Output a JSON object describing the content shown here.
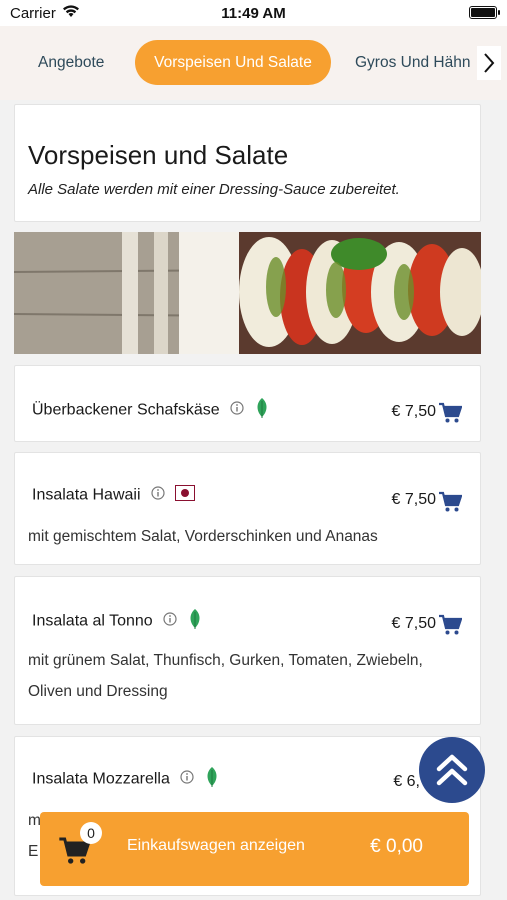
{
  "status_bar": {
    "carrier": "Carrier",
    "time": "11:49 AM"
  },
  "tabs": [
    {
      "label": "Angebote",
      "active": false
    },
    {
      "label": "Vorspeisen Und Salate",
      "active": true
    },
    {
      "label": "Gyros Und Hähn",
      "active": false
    }
  ],
  "section": {
    "title": "Vorspeisen und Salate",
    "subtitle": "Alle Salate werden mit einer Dressing-Sauce zubereitet."
  },
  "items": [
    {
      "name": "Überbackener Schafskäse",
      "price": "€ 7,50",
      "badge": "leaf-icon",
      "description": ""
    },
    {
      "name": "Insalata Hawaii",
      "price": "€ 7,50",
      "badge": "flag-icon",
      "description": "mit gemischtem Salat, Vorderschinken und Ananas"
    },
    {
      "name": "Insalata al Tonno",
      "price": "€ 7,50",
      "badge": "leaf-icon",
      "description_lines": [
        "mit grünem Salat, Thunfisch, Gurken, Tomaten, Zwiebeln,",
        "Oliven und Dressing"
      ]
    },
    {
      "name": "Insalata Mozzarella",
      "price": "€ 6,",
      "badge": "leaf-icon",
      "description_lines": [
        "m",
        "E"
      ]
    }
  ],
  "cart": {
    "count": "0",
    "label": "Einkaufswagen anzeigen",
    "total": "€ 0,00"
  },
  "colors": {
    "accent": "#f7a030",
    "navy": "#2c4a8e",
    "cart_icon": "#2c4a8e",
    "leaf": "#2fa35a"
  }
}
